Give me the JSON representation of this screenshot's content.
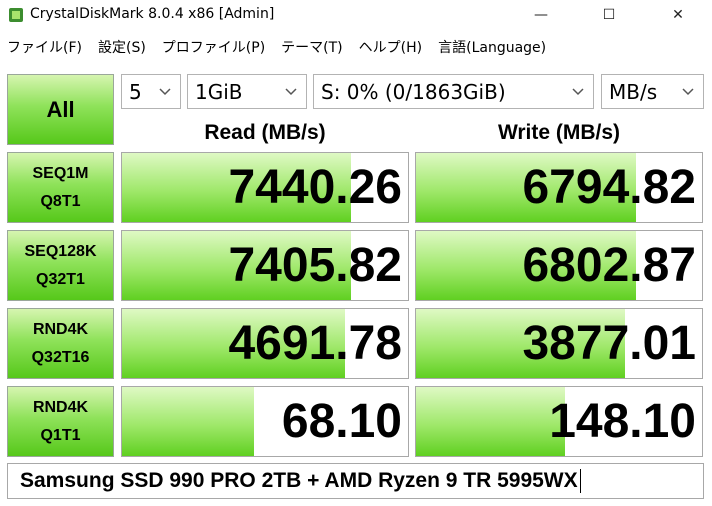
{
  "window": {
    "title": "CrystalDiskMark 8.0.4 x86 [Admin]",
    "minimize_glyph": "—",
    "maximize_glyph": "☐",
    "close_glyph": "✕"
  },
  "menu": [
    {
      "label": "ファイル(F)"
    },
    {
      "label": "設定(S)"
    },
    {
      "label": "プロファイル(P)"
    },
    {
      "label": "テーマ(T)"
    },
    {
      "label": "ヘルプ(H)"
    },
    {
      "label": "言語(Language)"
    }
  ],
  "controls": {
    "all_label": "All",
    "count": "5",
    "size": "1GiB",
    "drive": "S: 0% (0/1863GiB)",
    "unit": "MB/s"
  },
  "headers": {
    "read": "Read (MB/s)",
    "write": "Write (MB/s)"
  },
  "tests": [
    {
      "line1": "SEQ1M",
      "line2": "Q8T1",
      "read": "7440.26",
      "write": "6794.82",
      "read_fill": 0.8,
      "write_fill": 0.77
    },
    {
      "line1": "SEQ128K",
      "line2": "Q32T1",
      "read": "7405.82",
      "write": "6802.87",
      "read_fill": 0.8,
      "write_fill": 0.77
    },
    {
      "line1": "RND4K",
      "line2": "Q32T16",
      "read": "4691.78",
      "write": "3877.01",
      "read_fill": 0.78,
      "write_fill": 0.73
    },
    {
      "line1": "RND4K",
      "line2": "Q1T1",
      "read": "68.10",
      "write": "148.10",
      "read_fill": 0.46,
      "write_fill": 0.52
    }
  ],
  "comment": "Samsung SSD 990 PRO 2TB + AMD Ryzen 9 TR 5995WX",
  "colors": {
    "bar_green": "#60d021",
    "button_green": "#56c81a"
  }
}
